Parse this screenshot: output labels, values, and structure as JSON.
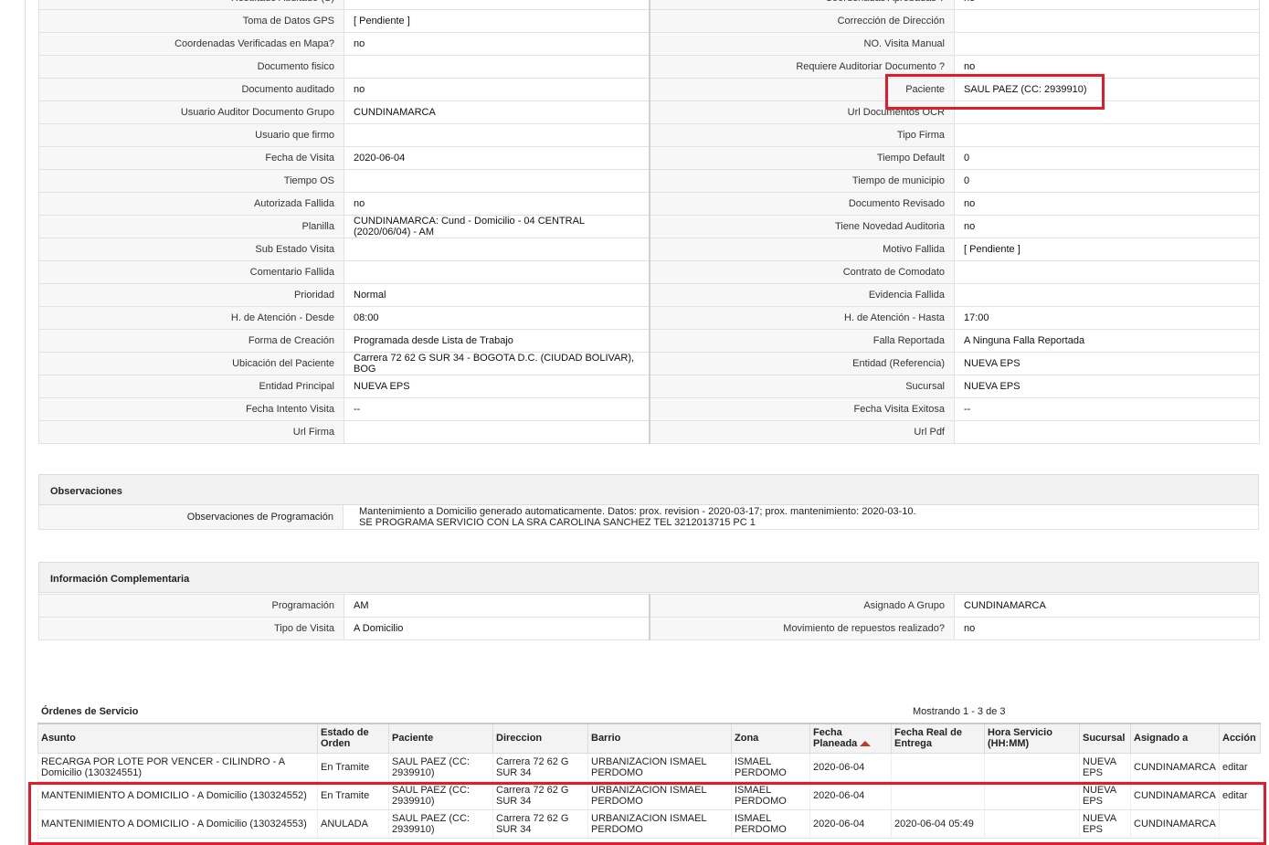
{
  "details": [
    [
      "Resultado Auditado (S)",
      "",
      "Coordenadas Aprobadas ?",
      "no"
    ],
    [
      "Toma de Datos GPS",
      "[ Pendiente ]",
      "Corrección de Dirección",
      ""
    ],
    [
      "Coordenadas Verificadas en Mapa?",
      "no",
      "NO. Visita Manual",
      ""
    ],
    [
      "Documento fisico",
      "",
      "Requiere Auditoriar Documento ?",
      "no"
    ],
    [
      "Documento auditado",
      "no",
      "Paciente",
      "SAUL PAEZ (CC: 2939910)"
    ],
    [
      "Usuario Auditor Documento Grupo",
      "CUNDINAMARCA",
      "Url Documentos OCR",
      ""
    ],
    [
      "Usuario que firmo",
      "",
      "Tipo Firma",
      ""
    ],
    [
      "Fecha de Visita",
      "2020-06-04",
      "Tiempo Default",
      "0"
    ],
    [
      "Tiempo OS",
      "",
      "Tiempo de municipio",
      "0"
    ],
    [
      "Autorizada Fallida",
      "no",
      "Documento Revisado",
      "no"
    ],
    [
      "Planilla",
      "CUNDINAMARCA: Cund - Domicilio - 04 CENTRAL (2020/06/04) - AM",
      "Tiene Novedad Auditoria",
      "no"
    ],
    [
      "Sub Estado Visita",
      "",
      "Motivo Fallida",
      "[ Pendiente ]"
    ],
    [
      "Comentario Fallida",
      "",
      "Contrato de Comodato",
      ""
    ],
    [
      "Prioridad",
      "Normal",
      "Evidencia Fallida",
      ""
    ],
    [
      "H. de Atención - Desde",
      "08:00",
      "H. de Atención - Hasta",
      "17:00"
    ],
    [
      "Forma de Creación",
      "Programada desde Lista de Trabajo",
      "Falla Reportada",
      "A Ninguna Falla Reportada"
    ],
    [
      "Ubicación del Paciente",
      "Carrera 72 62 G SUR 34 - BOGOTA D.C. (CIUDAD BOLIVAR), BOG",
      "Entidad (Referencia)",
      "NUEVA EPS"
    ],
    [
      "Entidad Principal",
      "NUEVA EPS",
      "Sucursal",
      "NUEVA EPS"
    ],
    [
      "Fecha Intento Visita",
      "--",
      "Fecha Visita Exitosa",
      "--"
    ],
    [
      "Url Firma",
      "",
      "Url Pdf",
      ""
    ]
  ],
  "observaciones": {
    "title": "Observaciones",
    "label": "Observaciones de Programación",
    "value": "Mantenimiento a Domicilio generado automaticamente. Datos: prox. revision - 2020-03-17; prox. mantenimiento: 2020-03-10.\nSE PROGRAMA SERVICIO CON LA SRA CAROLINA SANCHEZ TEL 3212013715 PC 1"
  },
  "info": {
    "title": "Información Complementaria",
    "rows": [
      [
        "Programación",
        "AM",
        "Asignado A Grupo",
        "CUNDINAMARCA"
      ],
      [
        "Tipo de Visita",
        "A Domicilio",
        "Movimiento de repuestos realizado?",
        "no"
      ]
    ]
  },
  "orders": {
    "title": "Órdenes de Servicio",
    "count": "Mostrando 1 - 3 de 3",
    "columns": [
      "Asunto",
      "Estado de Orden",
      "Paciente",
      "Direccion",
      "Barrio",
      "Zona",
      "Fecha Planeada",
      "Fecha Real de Entrega",
      "Hora Servicio (HH:MM)",
      "Sucursal",
      "Asignado a",
      "Acción"
    ],
    "rows": [
      [
        "RECARGA POR LOTE POR VENCER - CILINDRO - A Domicilio (130324551)",
        "En Tramite",
        "SAUL PAEZ (CC: 2939910)",
        "Carrera 72 62 G SUR 34",
        "URBANIZACION ISMAEL PERDOMO",
        "ISMAEL PERDOMO",
        "2020-06-04",
        "",
        "",
        "NUEVA EPS",
        "CUNDINAMARCA",
        "editar"
      ],
      [
        "MANTENIMIENTO A DOMICILIO - A Domicilio (130324552)",
        "En Tramite",
        "SAUL PAEZ (CC: 2939910)",
        "Carrera 72 62 G SUR 34",
        "URBANIZACION ISMAEL PERDOMO",
        "ISMAEL PERDOMO",
        "2020-06-04",
        "",
        "",
        "NUEVA EPS",
        "CUNDINAMARCA",
        "editar"
      ],
      [
        "MANTENIMIENTO A DOMICILIO - A Domicilio (130324553)",
        "ANULADA",
        "SAUL PAEZ (CC: 2939910)",
        "Carrera 72 62 G SUR 34",
        "URBANIZACION ISMAEL PERDOMO",
        "ISMAEL PERDOMO",
        "2020-06-04",
        "2020-06-04 05:49",
        "",
        "NUEVA EPS",
        "CUNDINAMARCA",
        ""
      ]
    ]
  },
  "colors": {
    "highlight": "#e01b2b",
    "label_bg": "#f7f7f7",
    "header_bg": "#f2f2f2"
  }
}
